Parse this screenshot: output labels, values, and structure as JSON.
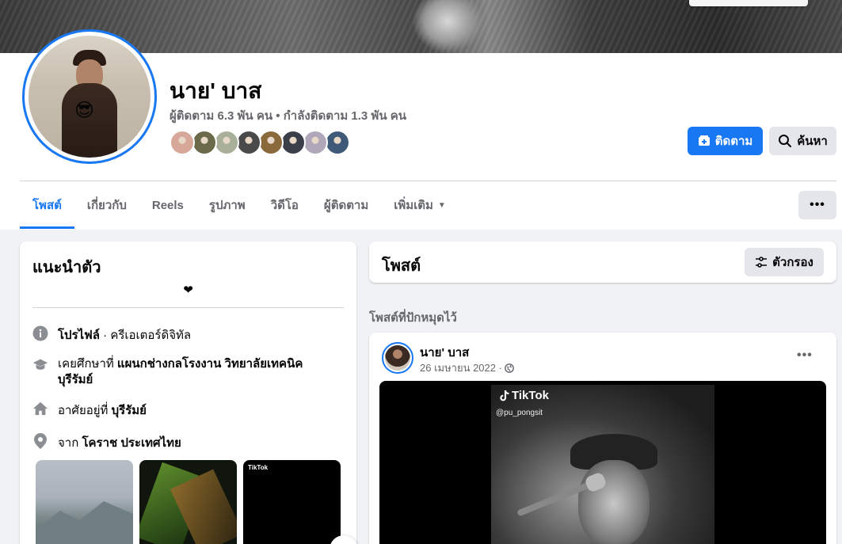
{
  "profile": {
    "name": "นาย' บาส",
    "stats": "ผู้ติดตาม 6.3 พัน คน • กำลังติดตาม 1.3 พัน คน",
    "avatar_emoji": "😎",
    "follower_avatar_colors": [
      "#d7a89a",
      "#6b6a4a",
      "#a8b09a",
      "#4a4a4a",
      "#8a6a3a",
      "#3a3f4a",
      "#b0a8b8",
      "#3e5a78"
    ]
  },
  "actions": {
    "follow_label": "ติดตาม",
    "search_label": "ค้นหา",
    "more_label": "•••"
  },
  "tabs": [
    {
      "label": "โพสต์",
      "active": true
    },
    {
      "label": "เกี่ยวกับ"
    },
    {
      "label": "Reels"
    },
    {
      "label": "รูปภาพ"
    },
    {
      "label": "วิดีโอ"
    },
    {
      "label": "ผู้ติดตาม"
    },
    {
      "label": "เพิ่มเติม"
    }
  ],
  "intro": {
    "title": "แนะนำตัว",
    "bio": "❤",
    "rows": [
      {
        "prefix": "โปรไฟล์",
        "rest": " · ครีเอเตอร์ดิจิทัล",
        "icon": "info-icon"
      },
      {
        "prefix": "เคยศึกษาที่ ",
        "bold": "แผนกช่างกลโรงงาน วิทยาลัยเทคนิค",
        "line2": "บุรีรัมย์",
        "icon": "graduation-cap-icon"
      },
      {
        "prefix": "อาศัยอยู่ที่ ",
        "bold": "บุรีรัมย์",
        "icon": "home-icon"
      },
      {
        "prefix": "จาก ",
        "bold": "โคราช ประเทศไทย",
        "icon": "location-pin-icon"
      }
    ],
    "photo_tiktok_text": "TikTok"
  },
  "posts": {
    "title": "โพสต์",
    "filter_label": "ตัวกรอง",
    "pinned_label": "โพสต์ที่ปักหมุดไว้",
    "post": {
      "author": "นาย' บาส",
      "date": "26 เมษายน 2022 ·",
      "more_label": "•••",
      "tiktok_brand": "TikTok",
      "tiktok_user": "@pu_pongsit"
    }
  }
}
